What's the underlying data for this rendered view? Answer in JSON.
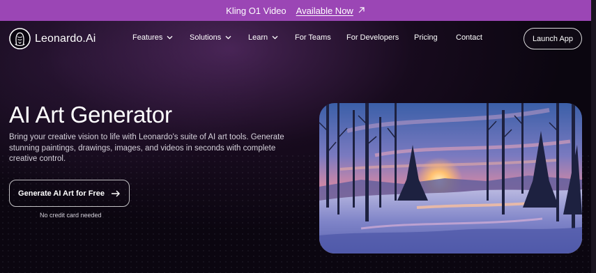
{
  "announcement": {
    "brand": "Kling O1 Video",
    "link_label": "Available Now",
    "arrow_icon": "arrow-up-right-icon",
    "background": "#9b46b5"
  },
  "nav": {
    "logo_text": "Leonardo.Ai",
    "items": [
      {
        "label": "Features",
        "has_dropdown": true
      },
      {
        "label": "Solutions",
        "has_dropdown": true
      },
      {
        "label": "Learn",
        "has_dropdown": true
      },
      {
        "label": "For Teams",
        "has_dropdown": false
      },
      {
        "label": "For Developers",
        "has_dropdown": false
      },
      {
        "label": "Pricing",
        "has_dropdown": false
      },
      {
        "label": "Contact",
        "has_dropdown": false
      }
    ],
    "launch_label": "Launch App"
  },
  "hero": {
    "title": "AI Art Generator",
    "subtitle": "Bring your creative vision to life with Leonardo's suite of AI art tools. Generate stunning paintings, drawings, images, and videos in seconds with complete creative control.",
    "cta_label": "Generate AI Art for Free",
    "cta_icon": "arrow-right-icon",
    "note": "No credit card needed",
    "image_subject": "snowy-forest-sunset-illustration"
  },
  "colors": {
    "background": "#0b0610",
    "accent_glow": "#783c8c",
    "text_muted": "#d6d2dc"
  }
}
